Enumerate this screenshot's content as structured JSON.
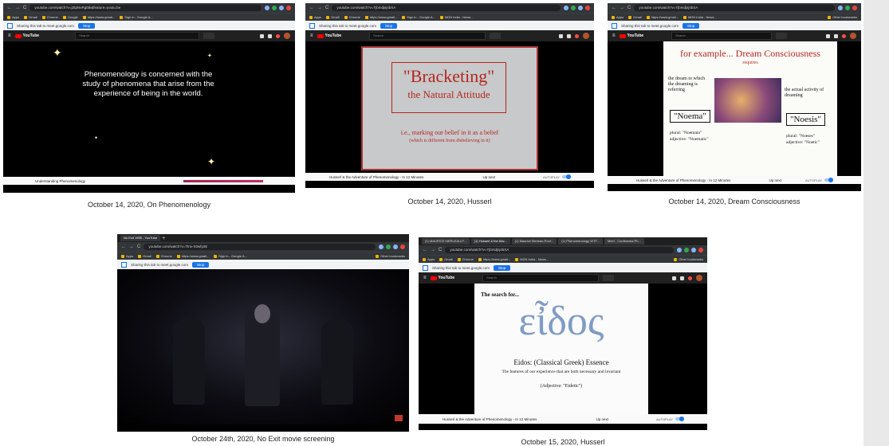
{
  "panels": [
    {
      "id": "p1",
      "caption": "October 14, 2020, On Phenomenology",
      "url": "youtube.com/watch?v=jZtpNvRgt5k&feature=youtu.be",
      "video_text": "Phenomenology is concerned with the study of phenomena that arise from the experience of being in the world.",
      "video_title": "Understanding Phenomenology"
    },
    {
      "id": "p2",
      "caption": "October 14, 2020, Husserl",
      "url": "youtube.com/watch?v=Tjbmdjsj4bXA",
      "slide_title1": "\"Bracketing\"",
      "slide_title2": "the Natural Attitude",
      "slide_line1": "i.e., marking our belief in it as a belief",
      "slide_line2": "(which is different from disbelieving in it)",
      "video_title": "Husserl & the Adventure of Phenomenology - In 12 Minutes"
    },
    {
      "id": "p3",
      "caption": "October 14, 2020, Dream Consciousness",
      "url": "youtube.com/watch?v=Tjbmdjsj4bXA",
      "slide_title": "for example... Dream Consciousness",
      "slide_sub": "requires",
      "left_text": "the dream to which the dreaming is referring",
      "right_text": "the actual activity of dreaming",
      "noema": "\"Noema\"",
      "noesis": "\"Noesis\"",
      "left_plural": "plural: \"Noemata\"",
      "left_adj": "adjective: \"Noematic\"",
      "right_plural": "plural: \"Noeses\"",
      "right_adj": "adjective: \"Noetic\"",
      "video_title": "Husserl & the Adventure of Phenomenology - In 12 Minutes"
    },
    {
      "id": "p4",
      "caption": "October 24th, 2020, No Exit movie screening",
      "tab_title": "No Exit 1995 - YouTube",
      "url": "youtube.com/watch?v=Tlnv-X0wfy2E"
    },
    {
      "id": "p5",
      "caption": "October 15, 2020, Husserl",
      "url": "youtube.com/watch?v=Tjbmdjsj4bXA",
      "tabs": [
        "(1) MAURICE MERLEAU-P...",
        "(1) Husserl & the Adv...",
        "(1) Maurice Merleau-Pont...",
        "(1) Phenomenology WTF...",
        "Meet - Continental Ph..."
      ],
      "slide_search": "The search for...",
      "slide_greek": "εἶδος",
      "slide_eidos": "Eidos:  (Classical Greek)  Essence",
      "slide_features": "The features of our experience that are both necessary and invariant",
      "slide_adj": "(Adjective: \"Eidetic\")",
      "video_title": "Husserl & the Adventure of Phenomenology - In 12 Minutes"
    }
  ],
  "browser": {
    "bookmarks": [
      "Apps",
      "Gmail",
      "Chrome",
      "Gmail",
      "Google",
      "https://www.gmail...",
      "Sign in - Google A...",
      "Google",
      "MDN India - News...",
      "Google"
    ],
    "other_bookmarks": "Other bookmarks",
    "share_text": "Sharing this tab to meet.google.com",
    "stop_label": "Stop",
    "search_placeholder": "Search",
    "yt_logo": "YouTube",
    "up_next": "Up next",
    "autoplay": "AUTOPLAY"
  },
  "colors": {
    "yt_red": "#ff0000",
    "accent_blue": "#1a73e8",
    "slide_red": "#b5261e"
  }
}
